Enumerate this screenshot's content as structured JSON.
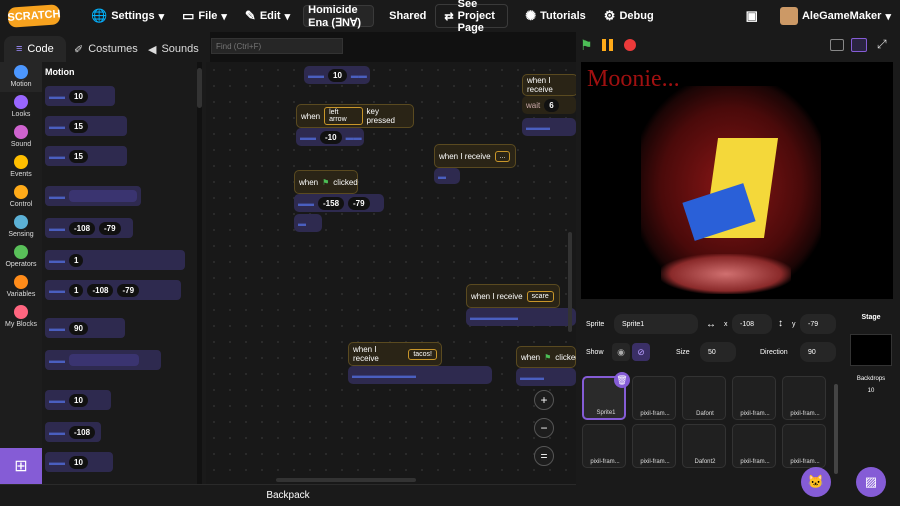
{
  "menubar": {
    "logo": "SCRATCH",
    "settings": "Settings",
    "file": "File",
    "edit": "Edit",
    "project_title": "Homicide Ena (∃N∀)",
    "shared": "Shared",
    "see_project": "See Project Page",
    "tutorials": "Tutorials",
    "debug": "Debug",
    "username": "AleGameMaker"
  },
  "tabs": {
    "code": "Code",
    "costumes": "Costumes",
    "sounds": "Sounds"
  },
  "search": {
    "placeholder": "Find (Ctrl+F)"
  },
  "categories": [
    "Motion",
    "Looks",
    "Sound",
    "Events",
    "Control",
    "Sensing",
    "Operators",
    "Variables",
    "My Blocks"
  ],
  "category_colors": [
    "#4c97ff",
    "#9966ff",
    "#cf63cf",
    "#ffbf00",
    "#ffab19",
    "#5cb1d6",
    "#59c059",
    "#ff8c1a",
    "#ff6680"
  ],
  "palette": {
    "heading": "Motion",
    "values": [
      "10",
      "15",
      "15",
      "-108",
      "-79",
      "1",
      "1",
      "-108",
      "-79",
      "90",
      "10",
      "-108",
      "10"
    ]
  },
  "workspace": {
    "b1_val": "10",
    "b2_event": "when",
    "b2_key": "left arrow",
    "b2_pressed": "key pressed",
    "b2_val": "-10",
    "b3_when": "when",
    "b3_clicked": "clicked",
    "b3_x": "-158",
    "b3_y": "-79",
    "b4_when": "when I receive",
    "b4_msg": "...",
    "b5_when": "when I receive",
    "b5_val": "6",
    "b6_when": "when I receive",
    "b6_msg": "scare",
    "b7_when": "when I receive",
    "b7_msg": "tacos!",
    "b8_when": "when",
    "b8_clicked": "clicked"
  },
  "zoom": {
    "in": "+",
    "out": "−",
    "reset": "="
  },
  "backpack": "Backpack",
  "stage_text": "Moonie...",
  "sprite": {
    "label": "Sprite",
    "name": "Sprite1",
    "x_label": "x",
    "x": "-108",
    "y_label": "y",
    "y": "-79",
    "show_label": "Show",
    "size_label": "Size",
    "size": "50",
    "direction_label": "Direction",
    "direction": "90"
  },
  "sprites": [
    "Sprite1",
    "pixil-fram...",
    "Dafont",
    "pixil-fram...",
    "pixil-fram...",
    "pixil-fram...",
    "pixil-fram...",
    "Dafont2",
    "pixil-fram...",
    "pixil-fram..."
  ],
  "stage_pane": {
    "title": "Stage",
    "backdrops_label": "Backdrops",
    "backdrops_count": "10"
  }
}
